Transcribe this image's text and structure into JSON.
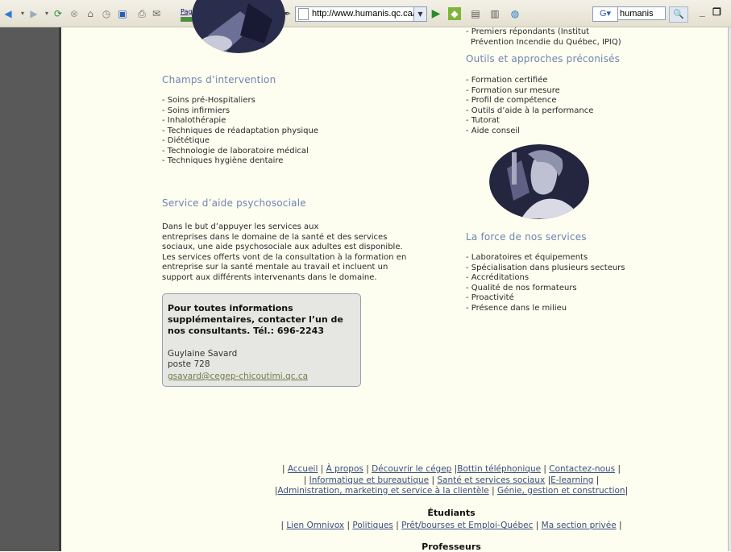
{
  "toolbar": {
    "pagerank_label": "PageRank",
    "address": "http://www.humanis.qc.ca/sante.",
    "google_label": "G",
    "search_value": "humanis",
    "window_controls": [
      "_",
      "❐"
    ]
  },
  "right_top": {
    "line1": "- Premiers répondants (Institut",
    "line2": "Prévention Incendie du Québec, IPIQ)"
  },
  "outils": {
    "heading": "Outils et approches préconisés",
    "items": [
      "- Formation certifiée",
      "- Formation sur mesure",
      "- Profil de compétence",
      "- Outils d’aide à la performance",
      "- Tutorat",
      "- Aide conseil"
    ]
  },
  "champs": {
    "heading": "Champs d’intervention",
    "items": [
      "- Soins pré-Hospitaliers",
      "- Soins infirmiers",
      "- Inhalothérapie",
      "- Techniques de réadaptation physique",
      "- Diététique",
      "- Technologie de laboratoire médical",
      "- Techniques hygiène dentaire"
    ]
  },
  "psycho": {
    "heading": "Service d’aide psychosociale",
    "lines": [
      "Dans le but d’appuyer les services aux",
      "entreprises dans le domaine de la santé et des services",
      "sociaux, une aide psychosociale aux adultes est disponible.",
      "Les services offerts vont de la consultation à la formation en",
      "entreprise sur la santé mentale au travail et incluent un",
      "support aux différents intervenants dans le domaine."
    ]
  },
  "force": {
    "heading": "La force de nos services",
    "items": [
      "- Laboratoires et équipements",
      "- Spécialisation dans plusieurs secteurs",
      "- Accréditations",
      "- Qualité de nos formateurs",
      "- Proactivité",
      "- Présence dans le milieu"
    ]
  },
  "contact": {
    "title": "Pour toutes informations supplémentaires, contacter l’un de nos consultants. Tél.: 696-2243",
    "name": "Guylaine Savard",
    "poste": "poste 728",
    "email": "gsavard@cegep-chicoutimi.qc.ca"
  },
  "footer": {
    "row1": [
      "Accueil",
      "À propos",
      "Découvrir le cégep",
      "Bottin téléphonique",
      "Contactez-nous"
    ],
    "row2": [
      "Informatique et bureautique",
      "Santé et services sociaux",
      "E-learning"
    ],
    "row3": [
      "Administration, marketing et service à la clientèle",
      "Génie, gestion et construction"
    ],
    "etudiants_heading": "Étudiants",
    "row4": [
      "Lien Omnivox",
      "Politiques",
      "Prêt/bourses et Emploi-Québec",
      "Ma section privée"
    ],
    "professeurs_heading": "Professeurs"
  },
  "colors": {
    "heading": "#6f85b2",
    "link": "#3a4f7f",
    "page_bg": "#fdfdf0"
  }
}
